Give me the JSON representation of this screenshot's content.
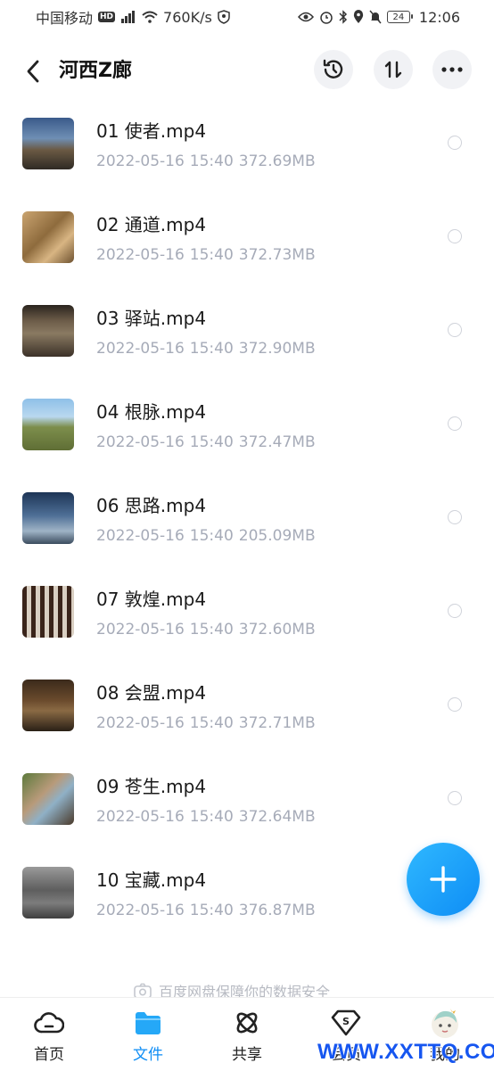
{
  "status_bar": {
    "carrier": "中国移动",
    "network_badge": "HD",
    "network_type": "4G",
    "speed": "760K/s",
    "battery": "24",
    "time": "12:06"
  },
  "header": {
    "title": "河西Z廊",
    "icons": [
      "back-icon",
      "history-icon",
      "sort-icon",
      "more-icon"
    ]
  },
  "files": [
    {
      "name": "01 使者.mp4",
      "date": "2022-05-16",
      "time": "15:40",
      "size": "372.69MB"
    },
    {
      "name": "02 通道.mp4",
      "date": "2022-05-16",
      "time": "15:40",
      "size": "372.73MB"
    },
    {
      "name": "03 驿站.mp4",
      "date": "2022-05-16",
      "time": "15:40",
      "size": "372.90MB"
    },
    {
      "name": "04 根脉.mp4",
      "date": "2022-05-16",
      "time": "15:40",
      "size": "372.47MB"
    },
    {
      "name": "06 思路.mp4",
      "date": "2022-05-16",
      "time": "15:40",
      "size": "205.09MB"
    },
    {
      "name": "07 敦煌.mp4",
      "date": "2022-05-16",
      "time": "15:40",
      "size": "372.60MB"
    },
    {
      "name": "08 会盟.mp4",
      "date": "2022-05-16",
      "time": "15:40",
      "size": "372.71MB"
    },
    {
      "name": "09 苍生.mp4",
      "date": "2022-05-16",
      "time": "15:40",
      "size": "372.64MB"
    },
    {
      "name": "10 宝藏.mp4",
      "date": "2022-05-16",
      "time": "15:40",
      "size": "376.87MB"
    }
  ],
  "safety_note": "百度网盘保障你的数据安全",
  "tabs": [
    {
      "label": "首页",
      "icon": "cloud-icon"
    },
    {
      "label": "文件",
      "icon": "folder-icon"
    },
    {
      "label": "共享",
      "icon": "share-atom-icon"
    },
    {
      "label": "会员",
      "icon": "vip-diamond-icon"
    },
    {
      "label": "我的",
      "icon": "avatar"
    }
  ],
  "watermark": "WWW.XXTTQ.COM",
  "colors": {
    "accent": "#0e8df5",
    "meta": "#a6abb8"
  }
}
